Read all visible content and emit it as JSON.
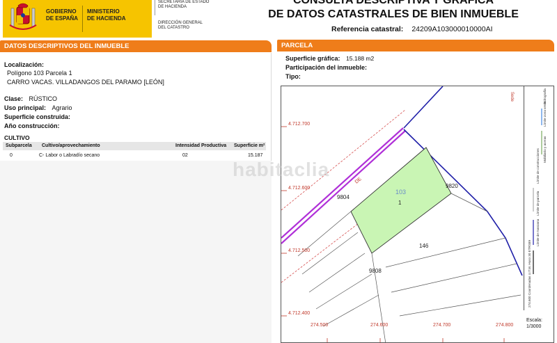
{
  "header": {
    "gobierno": [
      "GOBIERNO",
      "DE ESPAÑA"
    ],
    "ministerio": [
      "MINISTERIO",
      "DE HACIENDA"
    ],
    "secretaria": [
      "SECRETARÍA DE ESTADO",
      "DE HACIENDA"
    ],
    "direccion": [
      "DIRECCIÓN GENERAL",
      "DEL CATASTRO"
    ],
    "title_line1": "CONSULTA DESCRIPTIVA Y GRÁFICA",
    "title_line2": "DE DATOS CATASTRALES DE BIEN INMUEBLE",
    "ref_label": "Referencia catastral:",
    "ref_value": "24209A103000010000AI"
  },
  "left": {
    "section_title": "DATOS DESCRIPTIVOS DEL INMUEBLE",
    "localizacion_label": "Localización:",
    "localizacion_line1": "Polígono 103 Parcela 1",
    "localizacion_line2": "CARRO VACAS. VILLADANGOS DEL PARAMO [LEÓN]",
    "clase_label": "Clase:",
    "clase_value": "RÚSTICO",
    "uso_label": "Uso principal:",
    "uso_value": "Agrario",
    "superficie_label": "Superficie construida:",
    "anio_label": "Año construcción:",
    "cultivo_title": "CULTIVO",
    "cultivo_headers": {
      "subparcela": "Subparcela",
      "cultivo": "Cultivo/aprovechamiento",
      "intensidad": "Intensidad Productiva",
      "superficie": "Superficie m²"
    },
    "cultivo_row": {
      "subparcela": "0",
      "cultivo": "C- Labor o Labradío secano",
      "intensidad": "02",
      "superficie": "15.187"
    }
  },
  "right": {
    "section_title": "PARCELA",
    "sup_grafica_label": "Superficie gráfica:",
    "sup_grafica_value": "15.188 m2",
    "participacion_label": "Participación del inmueble:",
    "tipo_label": "Tipo:",
    "map": {
      "y_labels": [
        "4.712.700",
        "4.712.600",
        "4.712.500",
        "4.712.400"
      ],
      "x_labels": [
        "274.500",
        "274.600",
        "274.700",
        "274.800"
      ],
      "parcel_number": "103",
      "parcel_id": "1",
      "neighbors": [
        "9804",
        "9820",
        "146",
        "9808"
      ],
      "road_label": "DE",
      "legend_items": [
        "Límite de manzana",
        "Límite de parcela",
        "Límite de construcciones",
        "Mobiliario y aceras",
        "Límite zona verde",
        "Hidrografía"
      ],
      "coords_note": "274.600 Coordenadas U.T.M. Huso 30 ETRS89",
      "scale_label": "Escala:",
      "scale_value": "1/3000",
      "colors": {
        "parcel_fill": "#c9f5b4",
        "road": "#b030d8",
        "grid": "#c0392b",
        "boundary": "#1f1fa8"
      }
    },
    "watermark": "habitaclia"
  }
}
